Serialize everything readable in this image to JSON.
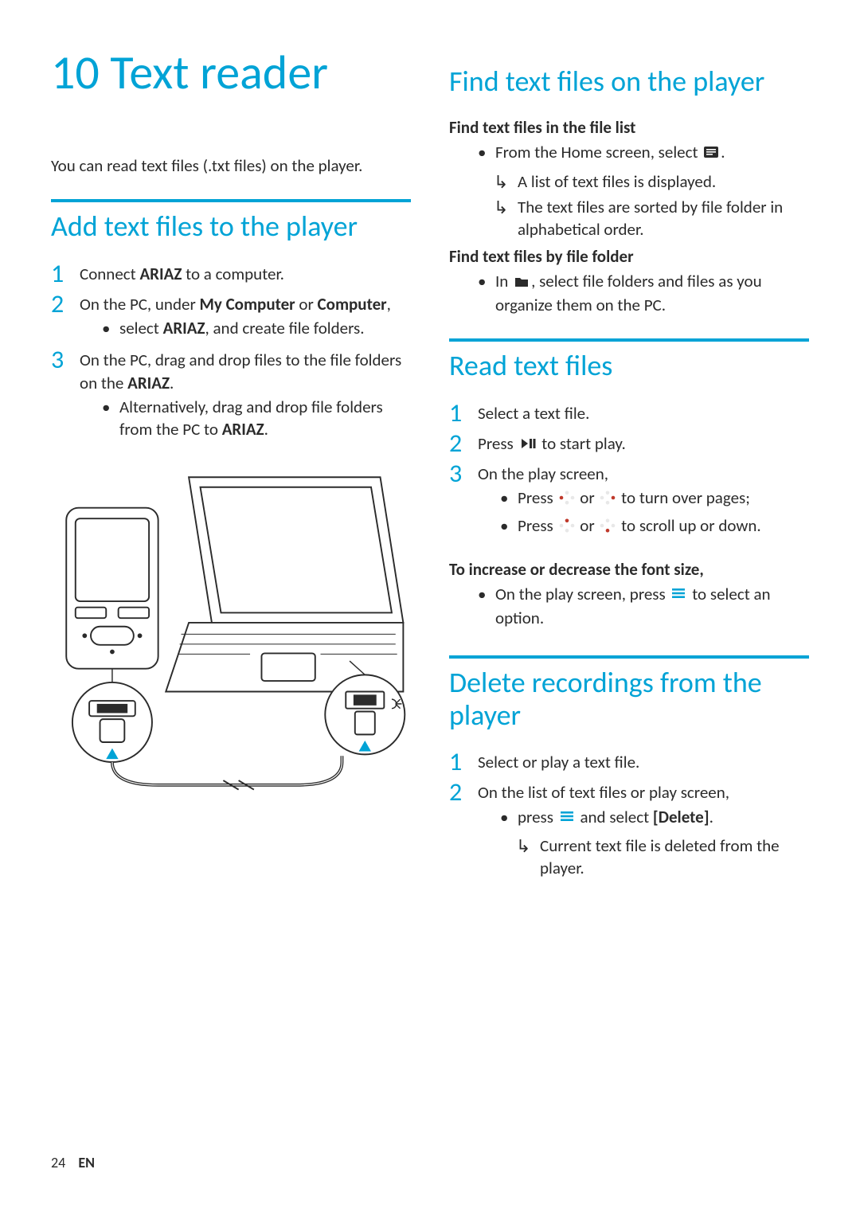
{
  "chapter": {
    "number": "10",
    "title": "Text reader"
  },
  "intro": "You can read text files (.txt files) on the player.",
  "footer": {
    "page": "24",
    "lang": "EN"
  },
  "icons": {
    "text": "text-list-icon",
    "folder": "folder-icon",
    "play": "play-pause-icon",
    "nav_left": "nav-left-icon",
    "nav_right": "nav-right-icon",
    "nav_up": "nav-up-icon",
    "nav_down": "nav-down-icon",
    "menu": "menu-icon"
  },
  "add": {
    "heading": "Add text files to the player",
    "steps": [
      {
        "n": "1",
        "text_before": "Connect ",
        "bold1": "ARIAZ",
        "text_after": " to a computer."
      },
      {
        "n": "2",
        "text_before": "On the PC, under ",
        "bold1": "My Computer",
        "mid": " or ",
        "bold2": "Computer",
        "after": ",",
        "bullets": [
          {
            "before": "select ",
            "bold": "ARIAZ",
            "after": ", and create file folders."
          }
        ]
      },
      {
        "n": "3",
        "line1_before": "On the PC, drag and drop files to the file folders on the ",
        "line1_bold": "ARIAZ",
        "line1_after": ".",
        "bullets": [
          {
            "before": "Alternatively, drag and drop file folders from the PC to ",
            "bold": "ARIAZ",
            "after": "."
          }
        ]
      }
    ]
  },
  "find": {
    "heading": "Find text files on the player",
    "group1": {
      "subhead": "Find text files in the file list",
      "bullet": {
        "before": "From the Home screen, select ",
        "after": "."
      },
      "results": [
        "A list of text files is displayed.",
        "The text files are sorted by file folder in alphabetical order."
      ]
    },
    "group2": {
      "subhead": "Find text files by file folder",
      "bullet": {
        "before": "In ",
        "after": ", select file folders and files as you organize them on the PC."
      }
    }
  },
  "read": {
    "heading": "Read text files",
    "steps": [
      {
        "n": "1",
        "text": "Select a text file."
      },
      {
        "n": "2",
        "before": "Press ",
        "after": " to start play."
      },
      {
        "n": "3",
        "text": "On the play screen,",
        "bullets": [
          {
            "before": "Press ",
            "mid": " or ",
            "after": " to turn over pages;"
          },
          {
            "before": "Press ",
            "mid": " or ",
            "after": " to scroll up or down."
          }
        ]
      }
    ],
    "font": {
      "subhead": "To increase or decrease the font size,",
      "bullet": {
        "before": "On the play screen, press ",
        "after": " to select an option."
      }
    }
  },
  "delete": {
    "heading": "Delete recordings from the player",
    "steps": [
      {
        "n": "1",
        "text": "Select or play a text file."
      },
      {
        "n": "2",
        "text": "On the list of text files or play screen,",
        "bullets": [
          {
            "before": "press ",
            "mid": " and select ",
            "bold": "[Delete]",
            "after": "."
          }
        ],
        "results": [
          "Current text file is deleted from the player."
        ]
      }
    ]
  }
}
